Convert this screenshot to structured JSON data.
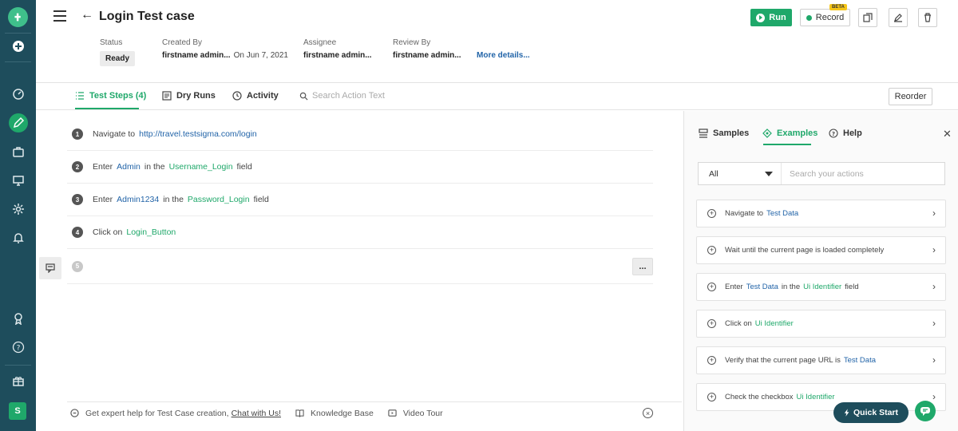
{
  "header": {
    "title": "Login Test case",
    "status_label": "Status",
    "status_value": "Ready",
    "created_by_label": "Created By",
    "created_by_value": "firstname admin...",
    "created_on": "On Jun 7, 2021",
    "assignee_label": "Assignee",
    "assignee_value": "firstname admin...",
    "review_label": "Review By",
    "review_value": "firstname admin...",
    "more_details": "More details...",
    "run_label": "Run",
    "record_label": "Record",
    "beta": "BETA"
  },
  "tabs": {
    "test_steps": "Test Steps (4)",
    "dry_runs": "Dry Runs",
    "activity": "Activity",
    "search_placeholder": "Search Action Text",
    "reorder": "Reorder"
  },
  "steps": [
    {
      "num": "1",
      "t1": "Navigate to",
      "url": "http://travel.testsigma.com/login"
    },
    {
      "num": "2",
      "t1": "Enter",
      "v1": "Admin",
      "t2": "in the",
      "v2": "Username_Login",
      "t3": "field"
    },
    {
      "num": "3",
      "t1": "Enter",
      "v1": "Admin1234",
      "t2": "in the",
      "v2": "Password_Login",
      "t3": "field"
    },
    {
      "num": "4",
      "t1": "Click on",
      "v2": "Login_Button"
    },
    {
      "num": "5"
    }
  ],
  "more_icon": "...",
  "help_bar": {
    "text": "Get expert help for Test Case creation,",
    "chat_link": "Chat with Us!",
    "knowledge": "Knowledge Base",
    "video": "Video Tour"
  },
  "right_panel": {
    "samples": "Samples",
    "examples": "Examples",
    "help": "Help",
    "filter_value": "All",
    "search_placeholder": "Search your actions",
    "cards": [
      {
        "t1": "Navigate to",
        "b1": "Test Data"
      },
      {
        "t1": "Wait until the current page is loaded completely"
      },
      {
        "t1": "Enter",
        "b1": "Test Data",
        "t2": "in the",
        "g1": "Ui Identifier",
        "t3": "field"
      },
      {
        "t1": "Click on",
        "g1": "Ui Identifier"
      },
      {
        "t1": "Verify that the current page URL is",
        "b1": "Test Data"
      },
      {
        "t1": "Check the checkbox",
        "g1": "Ui Identifier"
      }
    ]
  },
  "quick_start": "Quick Start",
  "sidebar": {
    "user_initial": "S"
  },
  "colors": {
    "sidebar": "#1e4d5c",
    "accent": "#1fa86a",
    "link": "#2264a8"
  }
}
